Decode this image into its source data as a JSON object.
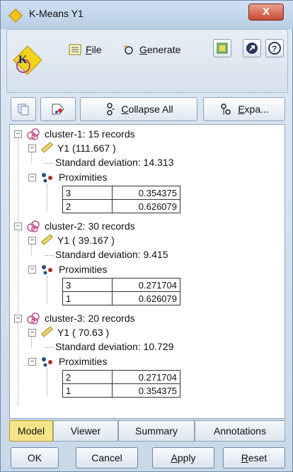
{
  "window": {
    "title": "K-Means Y1",
    "close_glyph": "X"
  },
  "toolbar": {
    "file_label_accel": "F",
    "file_label_rest": "ile",
    "generate_label_accel": "G",
    "generate_label_rest": "enerate"
  },
  "actions": {
    "collapse_all_accel": "C",
    "collapse_all_rest": "ollapse All",
    "expand_accel": "E",
    "expand_rest": "xpa..."
  },
  "clusters": [
    {
      "label": "cluster-1: 15 records",
      "field": "Y1 (111.667 )",
      "stddev": "Standard deviation: 14.313",
      "proximities_label": "Proximities",
      "proximities": [
        {
          "k": "3",
          "v": "0.354375"
        },
        {
          "k": "2",
          "v": "0.626079"
        }
      ]
    },
    {
      "label": "cluster-2: 30 records",
      "field": "Y1 ( 39.167 )",
      "stddev": "Standard deviation: 9.415",
      "proximities_label": "Proximities",
      "proximities": [
        {
          "k": "3",
          "v": "0.271704"
        },
        {
          "k": "1",
          "v": "0.626079"
        }
      ]
    },
    {
      "label": "cluster-3: 20 records",
      "field": "Y1 ( 70.63 )",
      "stddev": "Standard deviation: 10.729",
      "proximities_label": "Proximities",
      "proximities": [
        {
          "k": "2",
          "v": "0.271704"
        },
        {
          "k": "1",
          "v": "0.354375"
        }
      ]
    }
  ],
  "tabs": [
    {
      "label": "Model",
      "active": true
    },
    {
      "label": "Viewer",
      "active": false
    },
    {
      "label": "Summary",
      "active": false
    },
    {
      "label": "Annotations",
      "active": false
    }
  ],
  "buttons": {
    "ok": "OK",
    "cancel": "Cancel",
    "apply_accel": "A",
    "apply_rest": "pply",
    "reset_accel": "R",
    "reset_rest": "eset"
  },
  "colors": {
    "accent": "#f3c21b",
    "active_tab": "#f7e48a",
    "cluster_icon": "#c0508a",
    "ruler_icon": "#c9b43a"
  },
  "icons": {
    "title": "kmeans-diamond-icon",
    "file": "file-menu-icon",
    "generate": "generate-icon",
    "export": "export-icon",
    "expand_panel": "expand-panel-icon",
    "help": "help-icon",
    "copy": "copy-icon",
    "tag": "tag-icon",
    "collapse": "collapse-icon",
    "expand": "expand-icon",
    "cluster": "cluster-icon",
    "field": "ruler-icon",
    "proximity": "proximity-icon"
  }
}
